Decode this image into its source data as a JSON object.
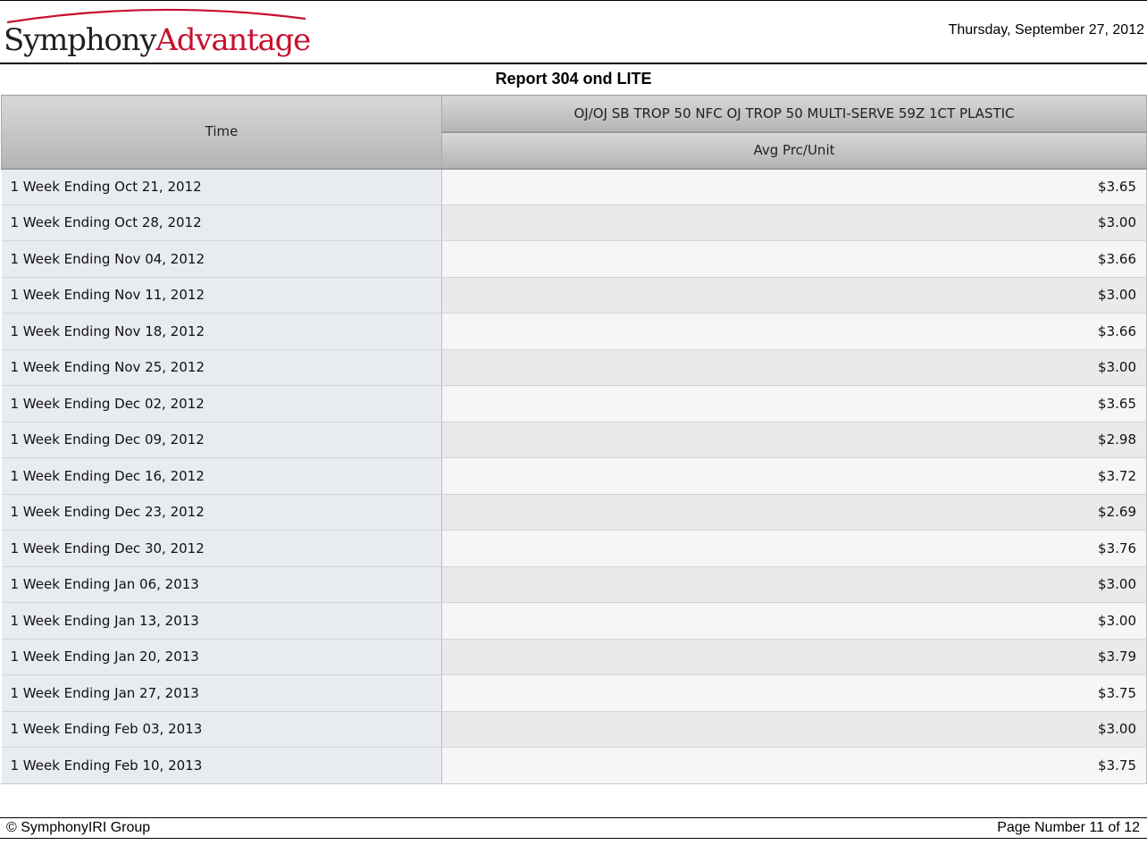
{
  "header": {
    "logo_part1": "Symphony",
    "logo_part2": "Advantage",
    "date": "Thursday, September 27, 2012"
  },
  "report": {
    "title": "Report 304 ond LITE"
  },
  "table": {
    "time_header": "Time",
    "product_header": "OJ/OJ SB TROP 50 NFC OJ TROP 50 MULTI-SERVE 59Z 1CT PLASTIC",
    "measure_header": "Avg Prc/Unit",
    "rows": [
      {
        "time": "1 Week Ending Oct 21, 2012",
        "value": "$3.65"
      },
      {
        "time": "1 Week Ending Oct 28, 2012",
        "value": "$3.00"
      },
      {
        "time": "1 Week Ending Nov 04, 2012",
        "value": "$3.66"
      },
      {
        "time": "1 Week Ending Nov 11, 2012",
        "value": "$3.00"
      },
      {
        "time": "1 Week Ending Nov 18, 2012",
        "value": "$3.66"
      },
      {
        "time": "1 Week Ending Nov 25, 2012",
        "value": "$3.00"
      },
      {
        "time": "1 Week Ending Dec 02, 2012",
        "value": "$3.65"
      },
      {
        "time": "1 Week Ending Dec 09, 2012",
        "value": "$2.98"
      },
      {
        "time": "1 Week Ending Dec 16, 2012",
        "value": "$3.72"
      },
      {
        "time": "1 Week Ending Dec 23, 2012",
        "value": "$2.69"
      },
      {
        "time": "1 Week Ending Dec 30, 2012",
        "value": "$3.76"
      },
      {
        "time": "1 Week Ending Jan 06, 2013",
        "value": "$3.00"
      },
      {
        "time": "1 Week Ending Jan 13, 2013",
        "value": "$3.00"
      },
      {
        "time": "1 Week Ending Jan 20, 2013",
        "value": "$3.79"
      },
      {
        "time": "1 Week Ending Jan 27, 2013",
        "value": "$3.75"
      },
      {
        "time": "1 Week Ending Feb 03, 2013",
        "value": "$3.00"
      },
      {
        "time": "1 Week Ending Feb 10, 2013",
        "value": "$3.75"
      }
    ]
  },
  "footer": {
    "copyright": "© SymphonyIRI Group",
    "page_number": "Page Number 11 of 12"
  },
  "colors": {
    "logo_dark": "#231f20",
    "logo_accent": "#c8102e",
    "time_cell_bg": "#e8ebf0",
    "header_gradient_top": "#d8d8d8",
    "header_gradient_bottom": "#b4b4b4"
  }
}
